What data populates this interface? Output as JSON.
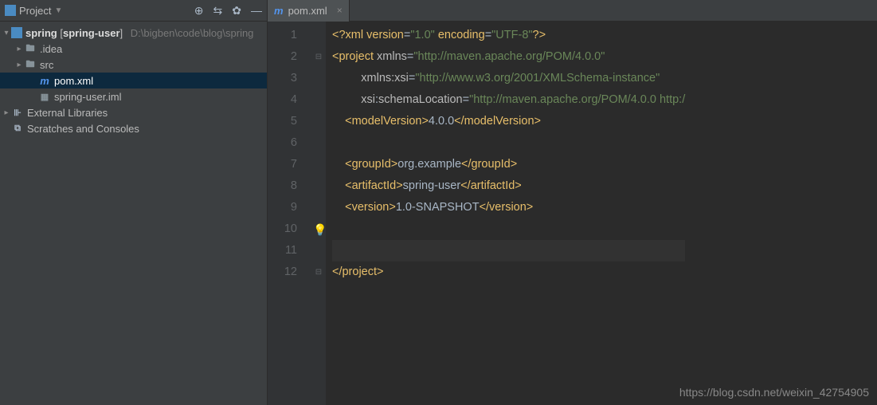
{
  "sidebar": {
    "title": "Project",
    "project": {
      "name": "spring",
      "module": "spring-user",
      "path": "D:\\bigben\\code\\blog\\spring"
    },
    "items": [
      {
        "label": ".idea",
        "type": "folder"
      },
      {
        "label": "src",
        "type": "folder"
      },
      {
        "label": "pom.xml",
        "type": "maven"
      },
      {
        "label": "spring-user.iml",
        "type": "iml"
      }
    ],
    "external": "External Libraries",
    "scratches": "Scratches and Consoles"
  },
  "tab": {
    "label": "pom.xml"
  },
  "code": {
    "lines": [
      {
        "n": 1,
        "tokens": [
          {
            "c": "pi",
            "t": "<?"
          },
          {
            "c": "tag",
            "t": "xml version"
          },
          {
            "c": "txt",
            "t": "="
          },
          {
            "c": "str",
            "t": "\"1.0\""
          },
          {
            "c": "txt",
            "t": " "
          },
          {
            "c": "tag",
            "t": "encoding"
          },
          {
            "c": "txt",
            "t": "="
          },
          {
            "c": "str",
            "t": "\"UTF-8\""
          },
          {
            "c": "pi",
            "t": "?>"
          }
        ]
      },
      {
        "n": 2,
        "tokens": [
          {
            "c": "tag",
            "t": "<project "
          },
          {
            "c": "attr",
            "t": "xmlns"
          },
          {
            "c": "txt",
            "t": "="
          },
          {
            "c": "str",
            "t": "\"http://maven.apache.org/POM/4.0.0\""
          }
        ]
      },
      {
        "n": 3,
        "tokens": [
          {
            "c": "txt",
            "t": "         "
          },
          {
            "c": "attr",
            "t": "xmlns:xsi"
          },
          {
            "c": "txt",
            "t": "="
          },
          {
            "c": "str",
            "t": "\"http://www.w3.org/2001/XMLSchema-instance\""
          }
        ]
      },
      {
        "n": 4,
        "tokens": [
          {
            "c": "txt",
            "t": "         "
          },
          {
            "c": "attr",
            "t": "xsi"
          },
          {
            "c": "txt",
            "t": ":"
          },
          {
            "c": "attr",
            "t": "schemaLocation"
          },
          {
            "c": "txt",
            "t": "="
          },
          {
            "c": "str",
            "t": "\"http://maven.apache.org/POM/4.0.0 http:/"
          }
        ]
      },
      {
        "n": 5,
        "tokens": [
          {
            "c": "txt",
            "t": "    "
          },
          {
            "c": "tag",
            "t": "<modelVersion>"
          },
          {
            "c": "txt",
            "t": "4.0.0"
          },
          {
            "c": "tag",
            "t": "</modelVersion>"
          }
        ]
      },
      {
        "n": 6,
        "tokens": []
      },
      {
        "n": 7,
        "tokens": [
          {
            "c": "txt",
            "t": "    "
          },
          {
            "c": "tag",
            "t": "<groupId>"
          },
          {
            "c": "txt",
            "t": "org.example"
          },
          {
            "c": "tag",
            "t": "</groupId>"
          }
        ]
      },
      {
        "n": 8,
        "tokens": [
          {
            "c": "txt",
            "t": "    "
          },
          {
            "c": "tag",
            "t": "<artifactId>"
          },
          {
            "c": "txt",
            "t": "spring-user"
          },
          {
            "c": "tag",
            "t": "</artifactId>"
          }
        ]
      },
      {
        "n": 9,
        "tokens": [
          {
            "c": "txt",
            "t": "    "
          },
          {
            "c": "tag",
            "t": "<version>"
          },
          {
            "c": "txt",
            "t": "1.0-SNAPSHOT"
          },
          {
            "c": "tag",
            "t": "</version>"
          }
        ]
      },
      {
        "n": 10,
        "tokens": []
      },
      {
        "n": 11,
        "tokens": [],
        "highlight": true
      },
      {
        "n": 12,
        "tokens": [
          {
            "c": "tag",
            "t": "</project>"
          }
        ]
      }
    ]
  },
  "watermark": "https://blog.csdn.net/weixin_42754905"
}
